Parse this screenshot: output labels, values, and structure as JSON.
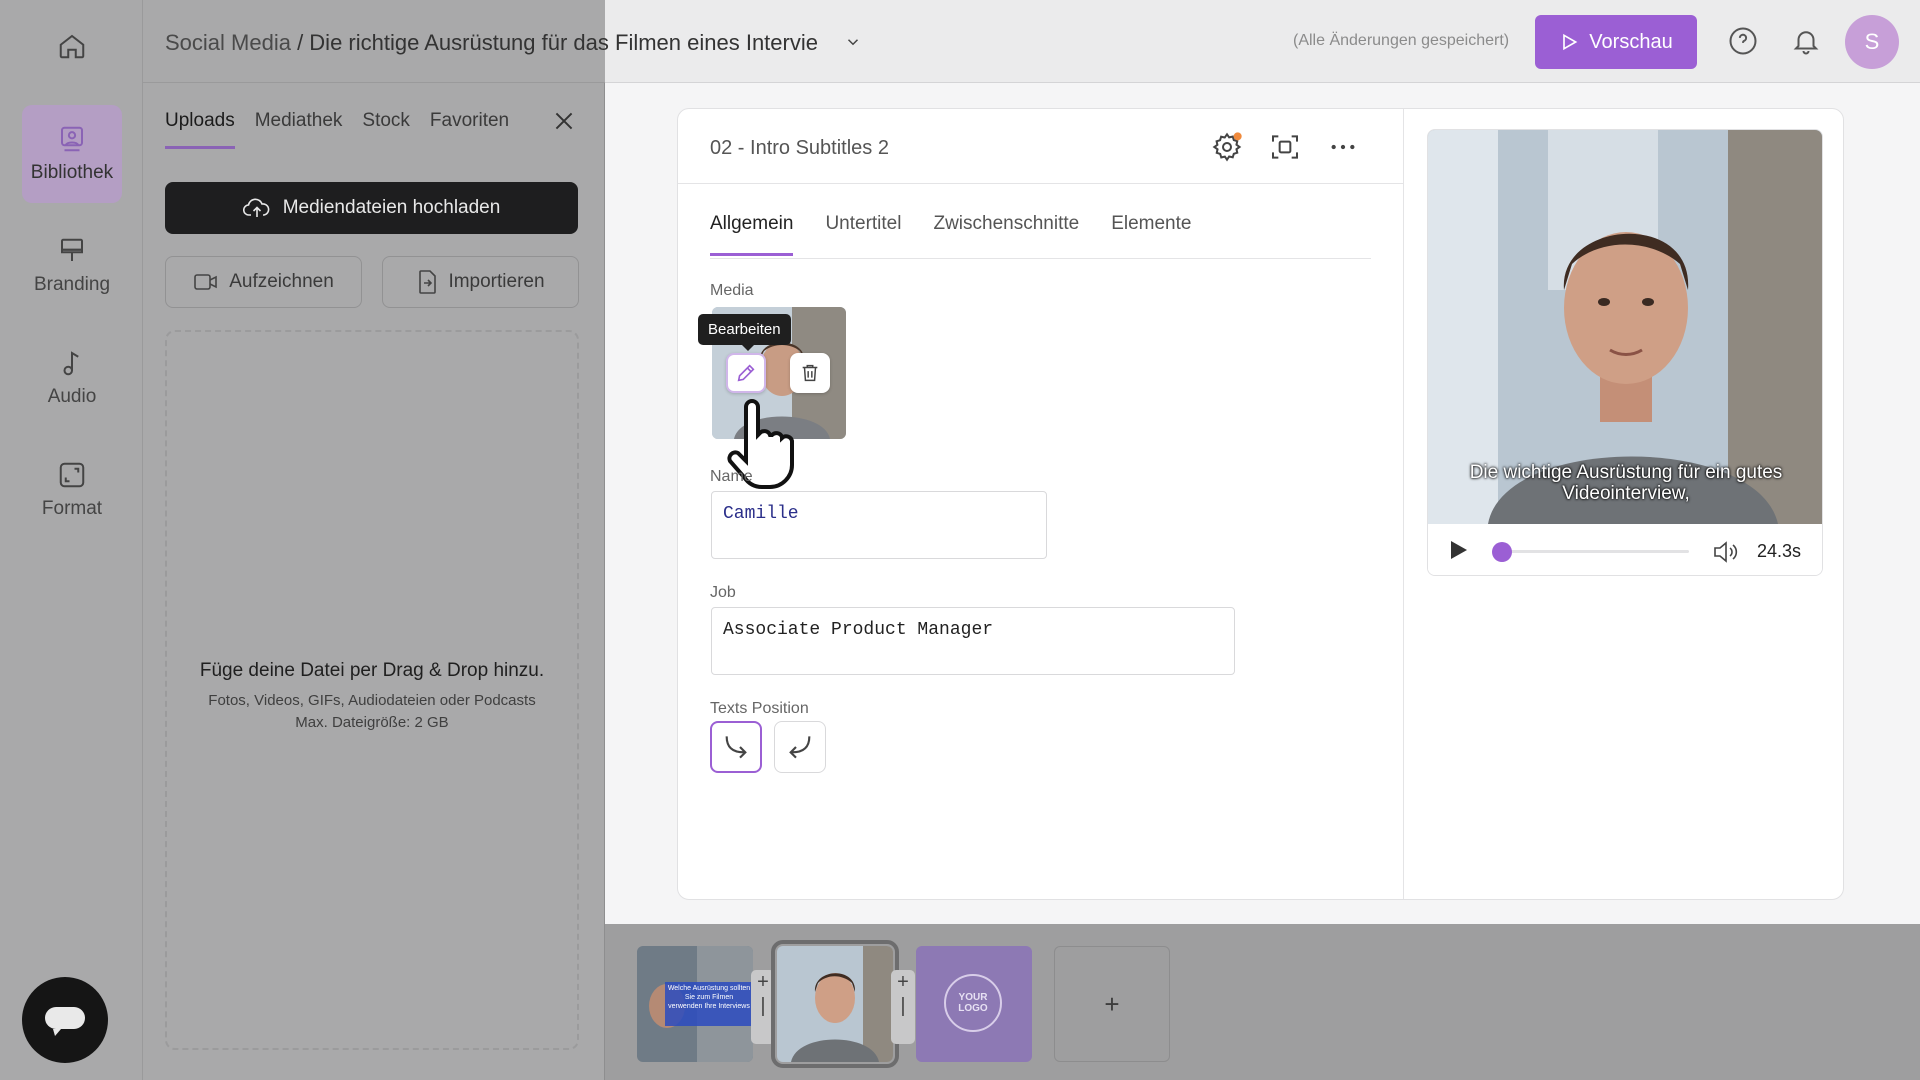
{
  "nav": {
    "items": [
      {
        "label": "Bibliothek",
        "icon": "library-icon",
        "active": true
      },
      {
        "label": "Branding",
        "icon": "brush-icon",
        "active": false
      },
      {
        "label": "Audio",
        "icon": "music-note-icon",
        "active": false
      },
      {
        "label": "Format",
        "icon": "format-icon",
        "active": false
      }
    ]
  },
  "panel": {
    "tabs": [
      "Uploads",
      "Mediathek",
      "Stock",
      "Favoriten"
    ],
    "upload_label": "Mediendateien hochladen",
    "record_label": "Aufzeichnen",
    "import_label": "Importieren",
    "drop_title": "Füge deine Datei per Drag & Drop hinzu.",
    "drop_types": "Fotos, Videos, GIFs, Audiodateien oder Podcasts",
    "drop_size": "Max. Dateigröße: 2 GB"
  },
  "header": {
    "crumb": "Social Media",
    "separator": " / ",
    "title": "Die richtige Ausrüstung für das Filmen eines Intervie",
    "saved": "(Alle Änderungen gespeichert)",
    "preview_label": "Vorschau",
    "avatar_initial": "S"
  },
  "editor": {
    "scene_title": "02 - Intro Subtitles 2",
    "tabs": [
      "Allgemein",
      "Untertitel",
      "Zwischenschnitte",
      "Elemente"
    ],
    "media_label": "Media",
    "tooltip": "Bearbeiten",
    "name_label": "Name",
    "name_value": "Camille",
    "job_label": "Job",
    "job_value": "Associate Product Manager",
    "position_label": "Texts Position"
  },
  "video": {
    "subtitle": "Die wichtige Ausrüstung für ein gutes Videointerview,",
    "time": "24.3s",
    "progress": 0.03
  },
  "timeline": {
    "scene1_text": "Welche Ausrüstung sollten Sie zum Filmen verwenden Ihre Interviews",
    "logo_text": "YOUR LOGO",
    "add_label": "+"
  },
  "colors": {
    "accent": "#9b5fd4",
    "overlay": "#a9a9aa"
  }
}
